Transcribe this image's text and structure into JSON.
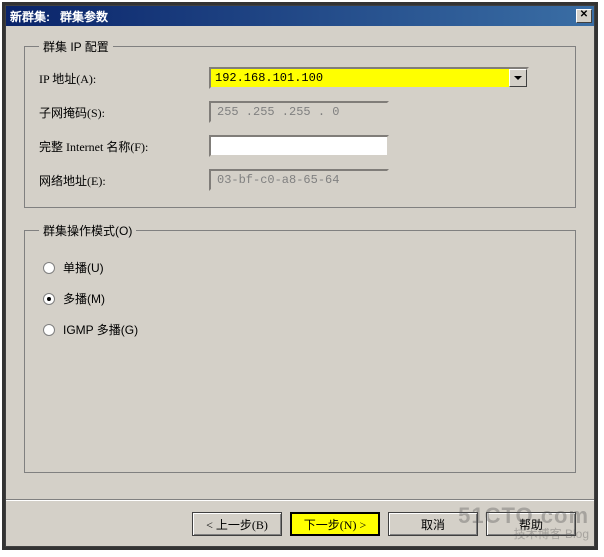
{
  "window": {
    "title": "新群集:   群集参数"
  },
  "ip_config": {
    "legend": "群集 IP 配置",
    "ip_label": "IP 地址(A):",
    "ip_value": "192.168.101.100",
    "subnet_label": "子网掩码(S):",
    "subnet_value": "255 .255 .255 . 0",
    "fqdn_label": "完整 Internet 名称(F):",
    "fqdn_value": "",
    "mac_label": "网络地址(E):",
    "mac_value": "03-bf-c0-a8-65-64"
  },
  "mode": {
    "legend": "群集操作模式(O)",
    "options": [
      {
        "label": "单播(U)",
        "selected": false
      },
      {
        "label": "多播(M)",
        "selected": true
      },
      {
        "label": "IGMP 多播(G)",
        "selected": false
      }
    ]
  },
  "buttons": {
    "back": "< 上一步(B)",
    "next": "下一步(N) >",
    "cancel": "取消",
    "help": "帮助"
  },
  "watermark": {
    "line1": "51CTO.com",
    "line2": "技术博客 Blog"
  }
}
